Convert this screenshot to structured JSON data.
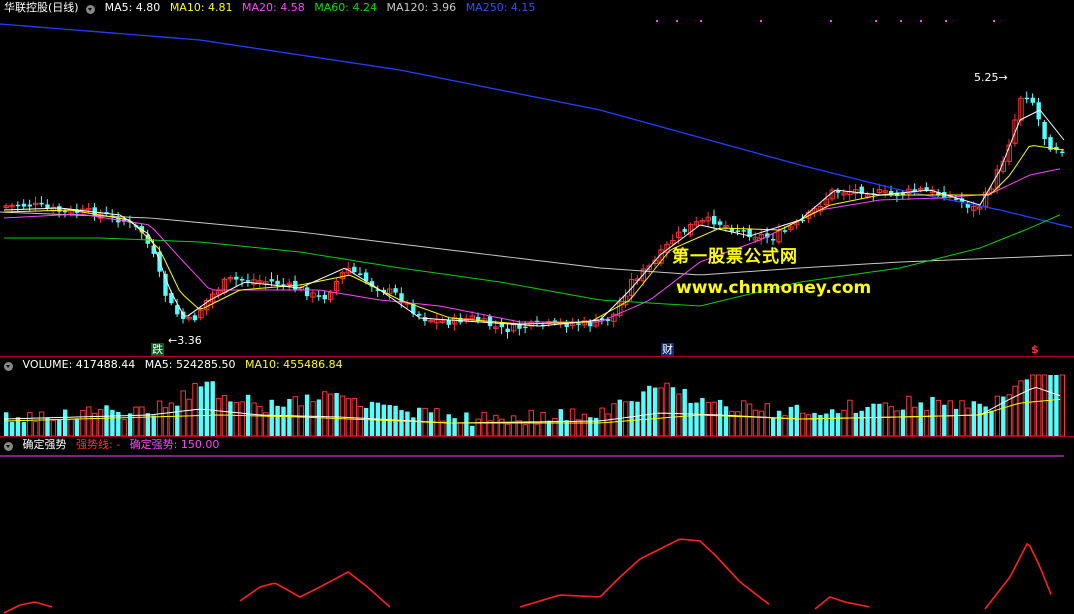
{
  "main": {
    "stock_name": "华联控股(日线)",
    "ma": [
      {
        "label": "MA5: 4.80",
        "color": "#ffffff"
      },
      {
        "label": "MA10: 4.81",
        "color": "#ffff00"
      },
      {
        "label": "MA20: 4.58",
        "color": "#ff00ff"
      },
      {
        "label": "MA60: 4.24",
        "color": "#00e000"
      },
      {
        "label": "MA120: 3.96",
        "color": "#c8c8c8"
      },
      {
        "label": "MA250: 4.15",
        "color": "#3050ff"
      }
    ],
    "low_label": "3.36",
    "high_label": "5.25",
    "event_mark_fall": "跌",
    "event_mark_finance": "财",
    "event_mark_dollar": "$",
    "watermark_title": "第一股票公式网",
    "watermark_url": "www.chnmoney.com"
  },
  "volume": {
    "title": "VOLUME: 417488.44",
    "ma5": "MA5: 524285.50",
    "ma10": "MA10: 455486.84"
  },
  "indicator": {
    "title": "确定强势",
    "line1_label": "强势线: -",
    "line2_label": "确定强势: 150.00"
  },
  "colors": {
    "up": "#ff3232",
    "down": "#54ffff",
    "line": "#ff0000",
    "divider": "#b4001e"
  }
}
